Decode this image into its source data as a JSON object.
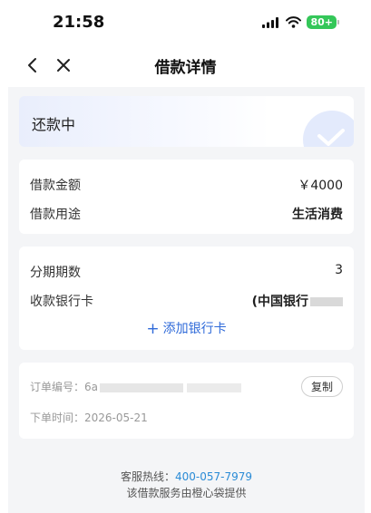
{
  "status_bar": {
    "time": "21:58",
    "battery": "80+"
  },
  "nav": {
    "title": "借款详情"
  },
  "loan_status": {
    "label": "还款中"
  },
  "amount_card": {
    "amount_label": "借款金额",
    "amount_value": "￥4000",
    "purpose_label": "借款用途",
    "purpose_value": "生活消费"
  },
  "bank_card": {
    "installments_label": "分期期数",
    "installments_value": "3",
    "bank_label": "收款银行卡",
    "bank_value": "(中国银行",
    "add_bank": "添加银行卡"
  },
  "order_card": {
    "order_no_label": "订单编号：",
    "order_no_value": "6a",
    "copy_label": "复制",
    "order_time_label": "下单时间：",
    "order_time_value": "2026-05-21"
  },
  "footer": {
    "hotline_label": "客服热线：",
    "hotline_number": "400-057-7979",
    "provider": "该借款服务由橙心袋提供"
  },
  "colors": {
    "accent": "#2f6ad9",
    "hotline": "#2a8bd6",
    "background": "#f4f5f7"
  }
}
